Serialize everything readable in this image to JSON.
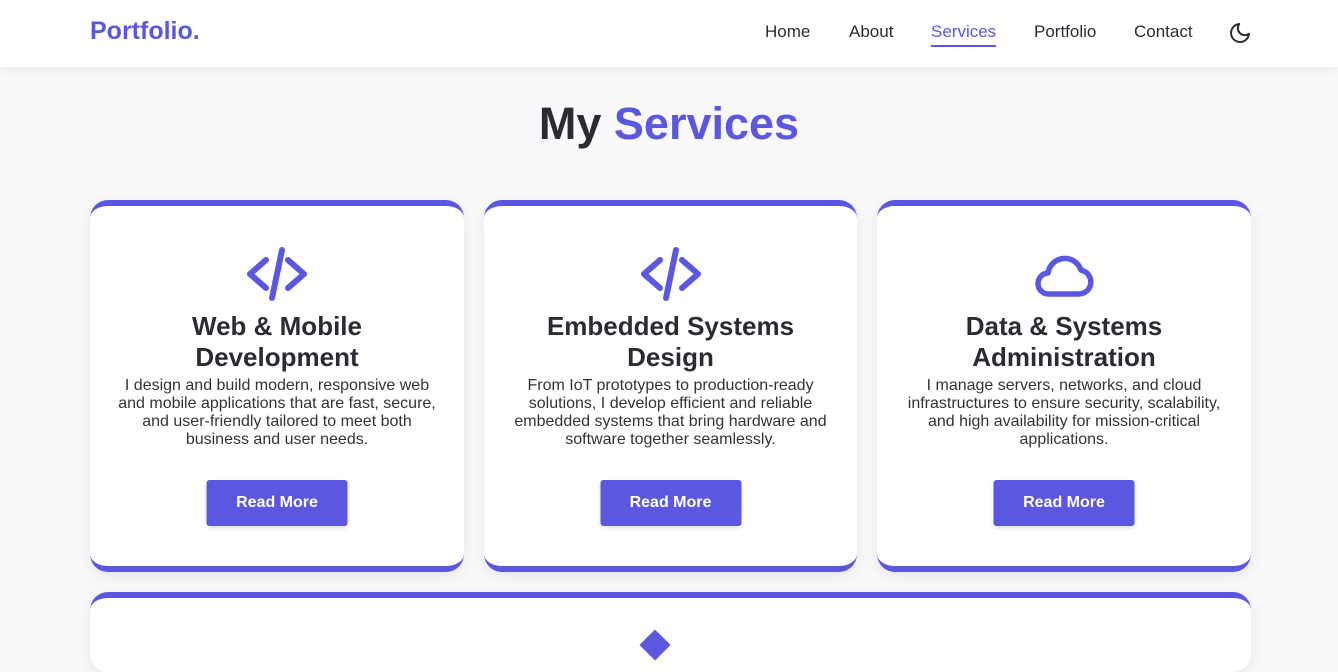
{
  "brand": {
    "logo": "Portfolio."
  },
  "nav": {
    "items": [
      {
        "label": "Home",
        "active": false
      },
      {
        "label": "About",
        "active": false
      },
      {
        "label": "Services",
        "active": true
      },
      {
        "label": "Portfolio",
        "active": false
      },
      {
        "label": "Contact",
        "active": false
      }
    ],
    "theme_toggle_icon": "moon-icon"
  },
  "section": {
    "title_plain": "My",
    "title_accent": "Services"
  },
  "services": [
    {
      "icon": "code-icon",
      "title": "Web & Mobile Development",
      "description": "I design and build modern, responsive web and mobile applications that are fast, secure, and user-friendly tailored to meet both business and user needs.",
      "button": "Read More"
    },
    {
      "icon": "code-icon",
      "title": "Embedded Systems Design",
      "description": "From IoT prototypes to production-ready solutions, I develop efficient and reliable embedded systems that bring hardware and software together seamlessly.",
      "button": "Read More"
    },
    {
      "icon": "cloud-icon",
      "title": "Data & Systems Administration",
      "description": "I manage servers, networks, and cloud infrastructures to ensure security, scalability, and high availability for mission-critical applications.",
      "button": "Read More"
    }
  ],
  "colors": {
    "accent": "#5b57e0",
    "text": "#2b2b33",
    "background": "#f9f9fb"
  }
}
